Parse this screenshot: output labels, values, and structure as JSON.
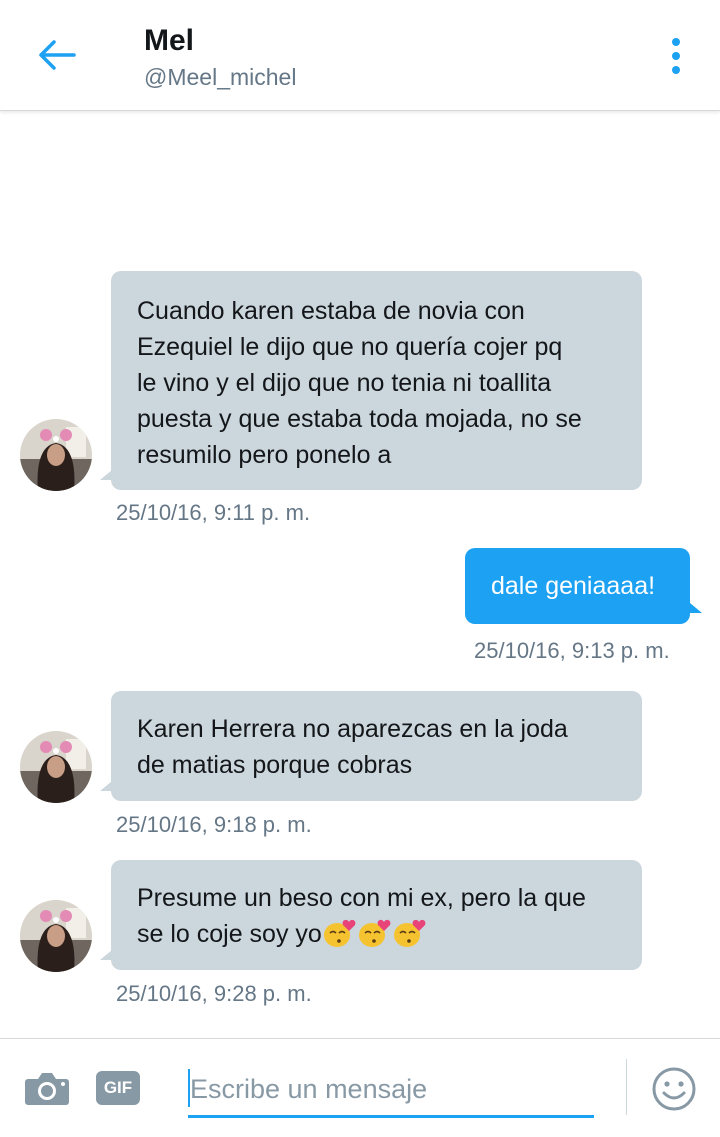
{
  "header": {
    "title": "Mel",
    "handle": "@Meel_michel"
  },
  "messages": [
    {
      "direction": "in",
      "lines": [
        "Cuando karen estaba de novia con",
        "Ezequiel le dijo que no quería cojer pq",
        "le vino y el dijo que no tenia ni toallita",
        "puesta y que estaba toda mojada, no se",
        "resumilo pero ponelo a"
      ],
      "timestamp": "25/10/16, 9:11 p. m."
    },
    {
      "direction": "out",
      "lines": [
        "dale geniaaaa!"
      ],
      "timestamp": "25/10/16, 9:13 p. m."
    },
    {
      "direction": "in",
      "lines": [
        "Karen Herrera no aparezcas en la joda",
        "de matias porque cobras"
      ],
      "timestamp": "25/10/16, 9:18 p. m."
    },
    {
      "direction": "in",
      "lines": [
        "Presume un beso con mi ex, pero la que",
        "se lo coje soy yo"
      ],
      "emoji": "kissing-face-with-heart",
      "emoji_count": 3,
      "timestamp": "25/10/16, 9:28 p. m."
    }
  ],
  "composer": {
    "placeholder": "Escribe un mensaje",
    "gif_label": "GIF"
  },
  "colors": {
    "accent": "#1da1f2",
    "incoming_bubble": "#ccd6dd",
    "secondary_text": "#657786"
  },
  "icons": [
    "back-arrow-icon",
    "more-options-icon",
    "camera-icon",
    "gif-icon",
    "smiley-icon"
  ]
}
